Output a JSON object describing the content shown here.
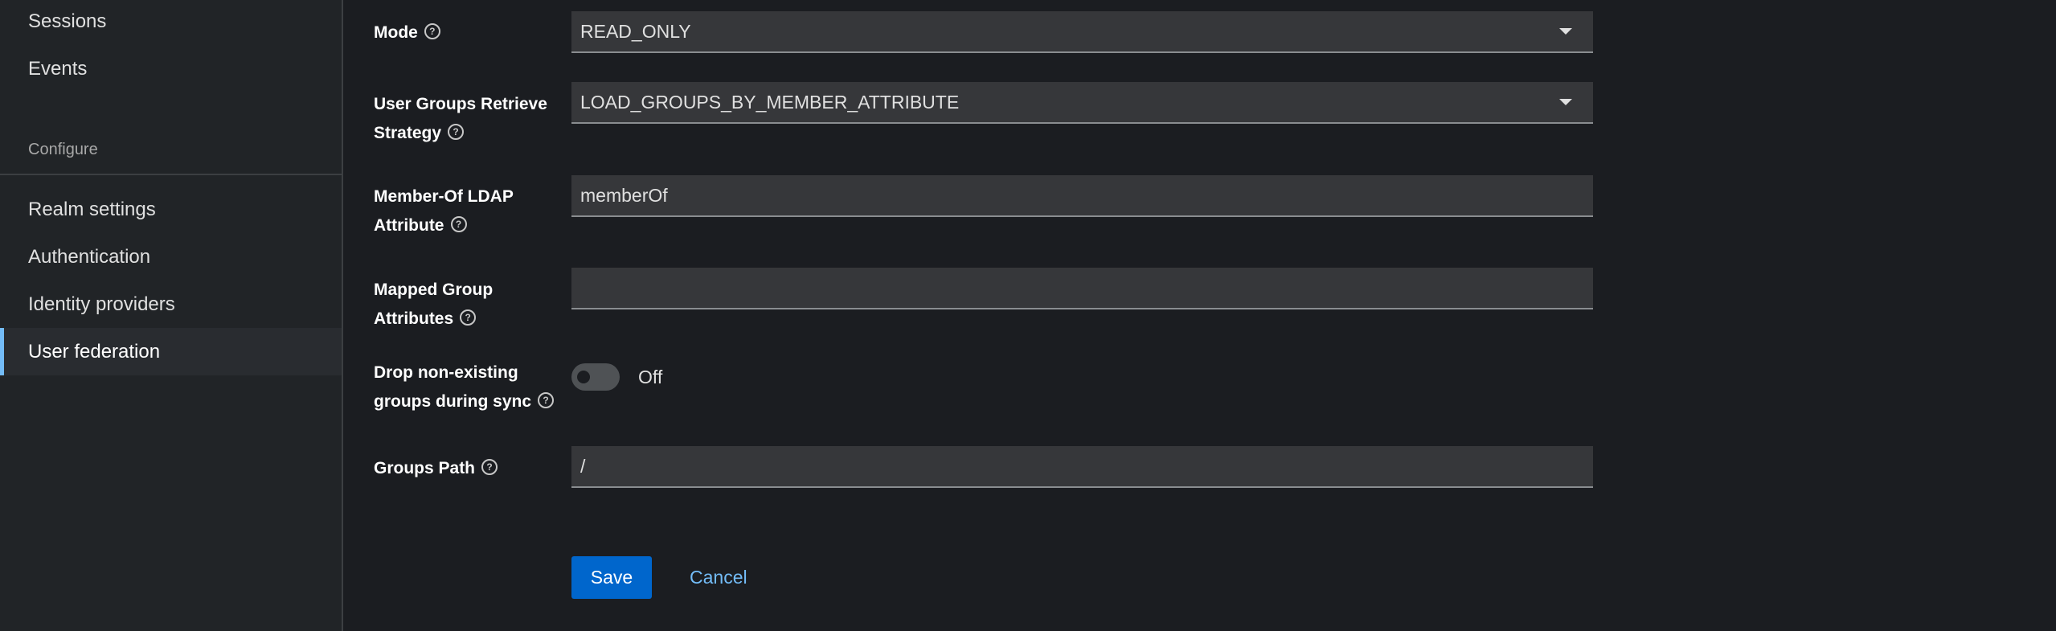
{
  "sidebar": {
    "items_top": [
      {
        "label": "Sessions"
      },
      {
        "label": "Events"
      }
    ],
    "section_label": "Configure",
    "items_configure": [
      {
        "label": "Realm settings"
      },
      {
        "label": "Authentication"
      },
      {
        "label": "Identity providers"
      },
      {
        "label": "User federation",
        "active": true
      }
    ]
  },
  "form": {
    "mode": {
      "label": "Mode",
      "value": "READ_ONLY"
    },
    "retrieve_strategy": {
      "label_line1": "User Groups Retrieve",
      "label_line2": "Strategy",
      "value": "LOAD_GROUPS_BY_MEMBER_ATTRIBUTE"
    },
    "member_of": {
      "label_line1": "Member-Of LDAP",
      "label_line2": "Attribute",
      "value": "memberOf"
    },
    "mapped_attrs": {
      "label_line1": "Mapped Group",
      "label_line2": "Attributes",
      "value": ""
    },
    "drop_groups": {
      "label_line1": "Drop non-existing",
      "label_line2": "groups during sync",
      "state_label": "Off"
    },
    "groups_path": {
      "label": "Groups Path",
      "value": "/"
    }
  },
  "actions": {
    "save_label": "Save",
    "cancel_label": "Cancel"
  },
  "icons": {
    "help": "?"
  },
  "colors": {
    "accent": "#73bcf7",
    "primary_button": "#0066cc",
    "background": "#1b1d21",
    "sidebar": "#212427"
  }
}
